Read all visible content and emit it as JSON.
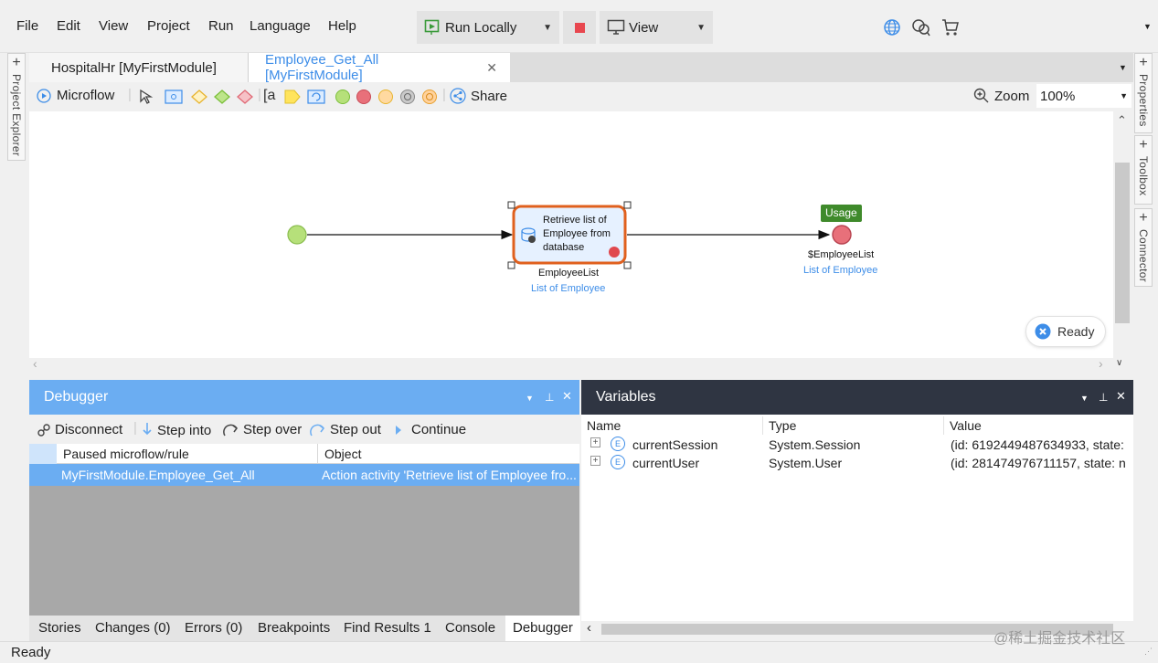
{
  "menubar": {
    "items": [
      "File",
      "Edit",
      "View",
      "Project",
      "Run",
      "Language",
      "Help"
    ],
    "run_locally": "Run Locally",
    "view_label": "View"
  },
  "side_panels": {
    "left": "Project Explorer",
    "right": [
      "Properties",
      "Toolbox",
      "Connector"
    ]
  },
  "tabs": [
    {
      "label": "HospitalHr [MyFirstModule]",
      "active": false
    },
    {
      "label": "Employee_Get_All [MyFirstModule]",
      "active": true
    }
  ],
  "mf_toolbar": {
    "microflow_label": "Microflow",
    "annotation_label": "[a",
    "share_label": "Share",
    "zoom_label": "Zoom",
    "zoom_value": "100%"
  },
  "canvas": {
    "activity_text": [
      "Retrieve list of",
      "Employee from",
      "database"
    ],
    "activity_output_name": "EmployeeList",
    "activity_output_type": "List of Employee",
    "usage_badge": "Usage",
    "end_name": "$EmployeeList",
    "end_type": "List of Employee",
    "ready_label": "Ready"
  },
  "debugger": {
    "title": "Debugger",
    "actions": [
      "Disconnect",
      "Step into",
      "Step over",
      "Step out",
      "Continue"
    ],
    "columns": [
      "Paused microflow/rule",
      "Object"
    ],
    "rows": [
      {
        "flow": "MyFirstModule.Employee_Get_All",
        "object": "Action activity 'Retrieve list of Employee fro..."
      }
    ]
  },
  "variables": {
    "title": "Variables",
    "columns": [
      "Name",
      "Type",
      "Value"
    ],
    "rows": [
      {
        "name": "currentSession",
        "type": "System.Session",
        "value": "(id: 6192449487634933, state:"
      },
      {
        "name": "currentUser",
        "type": "System.User",
        "value": "(id: 281474976711157, state: n"
      }
    ]
  },
  "bottom_tabs": [
    "Stories",
    "Changes (0)",
    "Errors (0)",
    "Breakpoints",
    "Find Results 1",
    "Console",
    "Debugger"
  ],
  "status": "Ready",
  "watermark": "@稀土掘金技术社区",
  "colors": {
    "accent_blue": "#6badf2",
    "selected_border": "#e0601e",
    "start_green": "#b6e07a",
    "end_red": "#e8707a",
    "usage_green": "#3f8a2b",
    "dark_header": "#2f3542"
  }
}
